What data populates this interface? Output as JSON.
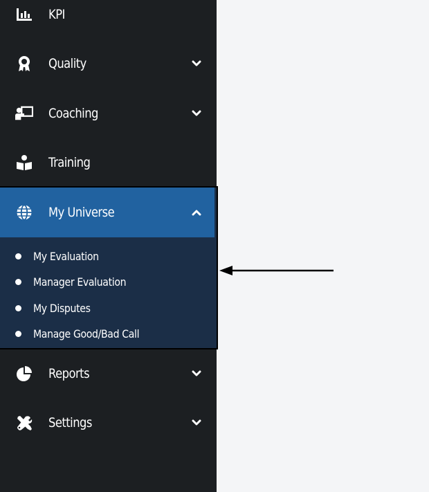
{
  "sidebar": {
    "items": [
      {
        "label": "KPI",
        "icon": "bar-chart-icon",
        "has_chevron": false
      },
      {
        "label": "Quality",
        "icon": "award-ribbon-icon",
        "has_chevron": true
      },
      {
        "label": "Coaching",
        "icon": "teacher-board-icon",
        "has_chevron": true
      },
      {
        "label": "Training",
        "icon": "reader-book-icon",
        "has_chevron": false
      },
      {
        "label": "My Universe",
        "icon": "globe-icon",
        "has_chevron": true,
        "expanded": true
      },
      {
        "label": "Reports",
        "icon": "pie-chart-icon",
        "has_chevron": true
      },
      {
        "label": "Settings",
        "icon": "tools-icon",
        "has_chevron": true
      }
    ],
    "submenu": [
      {
        "label": "My Evaluation"
      },
      {
        "label": "Manager Evaluation"
      },
      {
        "label": "My Disputes"
      },
      {
        "label": "Manage Good/Bad Call"
      }
    ]
  },
  "colors": {
    "sidebar_bg": "#1c1f22",
    "active_header": "#2162a0",
    "submenu_bg": "#1b2e47",
    "content_bg": "#f4f5f7"
  }
}
